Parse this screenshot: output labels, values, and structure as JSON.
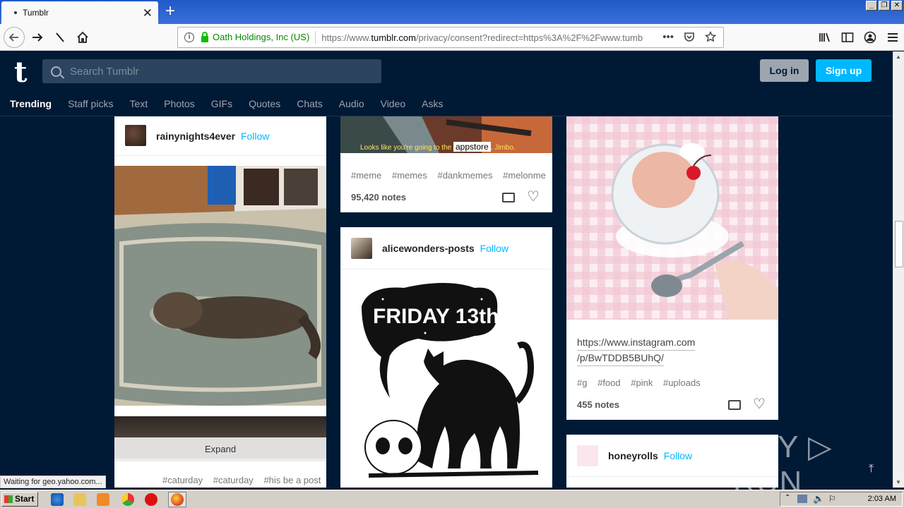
{
  "browser": {
    "tab_title": "Tumblr",
    "tab_close": "✕",
    "new_tab": "+",
    "window_buttons": [
      "_",
      "❐",
      "✕"
    ],
    "org": "Oath Holdings, Inc (US)",
    "url_prefix": "https://www.",
    "url_domain": "tumblr.com",
    "url_rest": "/privacy/consent?redirect=https%3A%2F%2Fwww.tumb"
  },
  "header": {
    "logo": "t",
    "search_placeholder": "Search Tumblr",
    "login_label": "Log in",
    "signup_label": "Sign up"
  },
  "nav": [
    "Trending",
    "Staff picks",
    "Text",
    "Photos",
    "GIFs",
    "Quotes",
    "Chats",
    "Audio",
    "Video",
    "Asks"
  ],
  "posts": {
    "left": {
      "username": "rainynights4ever",
      "follow": "Follow",
      "expand": "Expand",
      "tags": [
        "#caturday",
        "#caturday",
        "#his be a post"
      ]
    },
    "middle_top": {
      "caption_text": "Looks like you're going to the",
      "caption_box": "appstore",
      "caption_end": ", Jimbo.",
      "tags": [
        "#meme",
        "#memes",
        "#dankmemes",
        "#melonme"
      ],
      "notes": "95,420 notes"
    },
    "middle_bottom": {
      "username": "alicewonders-posts",
      "follow": "Follow",
      "art_title": "FRIDAY 13th"
    },
    "right_top": {
      "link_line1": "https://www.instagram.com",
      "link_line2": "/p/BwTDDB5BUhQ/",
      "tags": [
        "#g",
        "#food",
        "#pink",
        "#uploads"
      ],
      "notes": "455 notes"
    },
    "right_bottom": {
      "username": "honeyrolls",
      "follow": "Follow"
    }
  },
  "status_text": "Waiting for geo.yahoo.com...",
  "watermark": "ANY ▷ RUN",
  "taskbar": {
    "start": "Start",
    "clock": "2:03 AM"
  }
}
